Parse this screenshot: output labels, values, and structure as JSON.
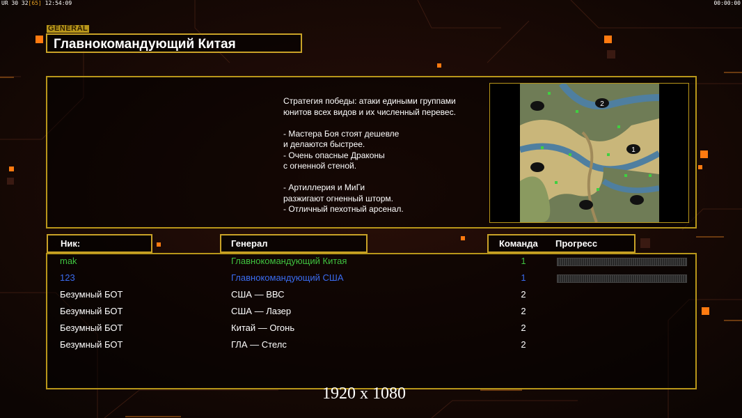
{
  "hud": {
    "left_prefix": "UR 30 32",
    "left_bracket": "[65]",
    "left_time": "12:54:09",
    "right_time": "00:00:00"
  },
  "header": {
    "tag": "GENERAL",
    "title": "Главнокомандующий Китая"
  },
  "description": [
    "Стратегия победы: атаки едиными группами",
    "юнитов всех видов и их численный перевес.",
    "",
    "- Мастера Боя стоят дешевле",
    "и делаются быстрее.",
    "- Очень опасные Драконы",
    "с огненной стеной.",
    "",
    "- Артиллерия и МиГи",
    "разжигают огненный шторм.",
    "- Отличный пехотный арсенал."
  ],
  "map": {
    "markers": [
      "2",
      "1"
    ]
  },
  "columns": {
    "nick": "Ник:",
    "general": "Генерал",
    "team": "Команда",
    "progress": "Прогресс"
  },
  "players": [
    {
      "nick": "mak",
      "general": "Главнокомандующий Китая",
      "team": "1",
      "color": "#3fc23f",
      "progress": 0
    },
    {
      "nick": "123",
      "general": "Главнокомандующий США",
      "team": "1",
      "color": "#3a6cf0",
      "progress": 0
    },
    {
      "nick": "Безумный БОТ",
      "general": "США — ВВС",
      "team": "2",
      "color": "#ffffff"
    },
    {
      "nick": "Безумный БОТ",
      "general": "США — Лазер",
      "team": "2",
      "color": "#ffffff"
    },
    {
      "nick": "Безумный БОТ",
      "general": "Китай — Огонь",
      "team": "2",
      "color": "#ffffff"
    },
    {
      "nick": "Безумный БОТ",
      "general": "ГЛА — Стелс",
      "team": "2",
      "color": "#ffffff"
    }
  ],
  "resolution_label": "1920 x 1080",
  "colors": {
    "accent": "#c9a227",
    "orange_light": "#ff7a10",
    "background": "#130806"
  }
}
